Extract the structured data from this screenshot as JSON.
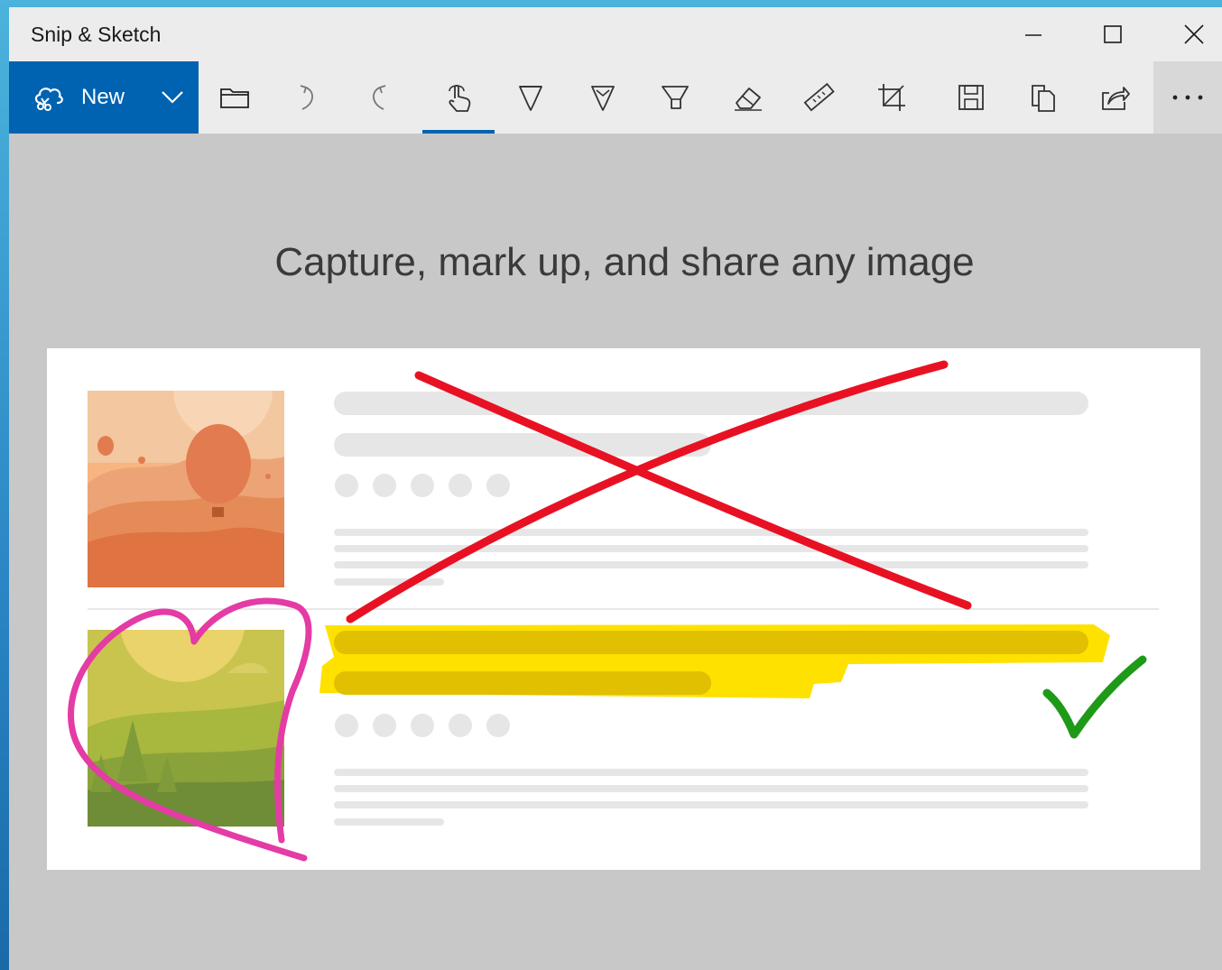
{
  "window": {
    "title": "Snip & Sketch",
    "controls": [
      {
        "name": "minimize",
        "icon": "minimize-icon"
      },
      {
        "name": "maximize",
        "icon": "maximize-icon"
      },
      {
        "name": "close",
        "icon": "close-icon"
      }
    ]
  },
  "toolbar": {
    "new_label": "New",
    "new_icon": "snip-icon",
    "tools": [
      {
        "name": "open-file",
        "icon": "folder-icon"
      },
      {
        "name": "undo",
        "icon": "undo-icon"
      },
      {
        "name": "redo",
        "icon": "redo-icon"
      },
      {
        "name": "touch-writing",
        "icon": "touch-writing-icon",
        "active": true
      },
      {
        "name": "ballpoint-pen",
        "icon": "ballpoint-pen-icon"
      },
      {
        "name": "pencil",
        "icon": "pencil-icon"
      },
      {
        "name": "highlighter",
        "icon": "highlighter-icon"
      },
      {
        "name": "eraser",
        "icon": "eraser-icon"
      },
      {
        "name": "ruler",
        "icon": "ruler-icon"
      },
      {
        "name": "crop",
        "icon": "crop-icon"
      },
      {
        "name": "save",
        "icon": "save-icon"
      },
      {
        "name": "copy",
        "icon": "copy-icon"
      },
      {
        "name": "share",
        "icon": "share-icon"
      }
    ],
    "more_icon": "more-icon"
  },
  "main": {
    "headline": "Capture, mark up, and share any image"
  },
  "colors": {
    "accent": "#0063b1",
    "red_ink": "#e81123",
    "highlight": "#ffe100",
    "pink_ink": "#e43ba5",
    "green_ink": "#1e9a18"
  }
}
